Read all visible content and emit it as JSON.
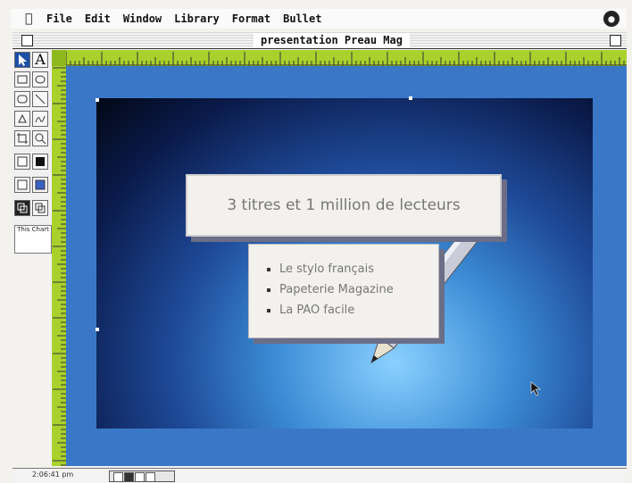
{
  "menubar": {
    "items": [
      "File",
      "Edit",
      "Window",
      "Library",
      "Format",
      "Bullet"
    ]
  },
  "window": {
    "title": "presentation Preau Mag"
  },
  "palette": {
    "chart_tool_label": "This Chart"
  },
  "slide": {
    "title": "3 titres et 1 million de lecteurs",
    "bullets": [
      "Le stylo français",
      "Papeterie Magazine",
      "La PAO facile"
    ]
  },
  "status": {
    "time": "2:06:41 pm"
  },
  "colors": {
    "ruler": "#a9d12c",
    "workspace": "#3a78c7",
    "slide_dark": "#020815",
    "slide_light": "#8bd0ff"
  }
}
